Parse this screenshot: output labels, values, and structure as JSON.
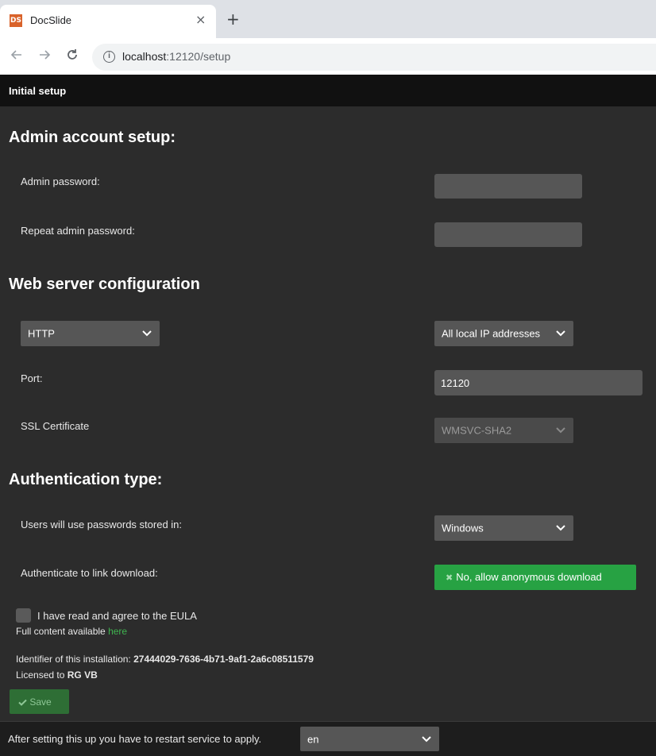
{
  "browser": {
    "tab_title": "DocSlide",
    "favicon_text": "DS",
    "close_glyph": "×",
    "new_tab_glyph": "+",
    "url_host": "localhost",
    "url_rest": ":12120/setup",
    "icons": [
      "back-arrow-icon",
      "forward-arrow-icon",
      "reload-icon",
      "info-icon"
    ]
  },
  "header": {
    "title": "Initial setup"
  },
  "admin": {
    "section_title": "Admin account setup:",
    "password_label": "Admin password:",
    "password_value": "",
    "repeat_label": "Repeat admin password:",
    "repeat_value": ""
  },
  "web": {
    "section_title": "Web server configuration",
    "protocol": "HTTP",
    "address": "All local IP addresses",
    "port_label": "Port:",
    "port_value": "12120",
    "ssl_label": "SSL Certificate",
    "ssl_value": "WMSVC-SHA2"
  },
  "auth": {
    "section_title": "Authentication type:",
    "store_label": "Users will use passwords stored in:",
    "store_value": "Windows",
    "link_label": "Authenticate to link download:",
    "link_button": "No, allow anonymous download"
  },
  "eula": {
    "checkbox_label": "I have read and agree to the EULA",
    "content_prefix": "Full content available",
    "content_link": "here",
    "checked": false
  },
  "install": {
    "identifier_label": "Identifier of this installation:",
    "identifier_value": "27444029-7636-4b71-9af1-2a6c08511579",
    "licensed_label": "Licensed to",
    "licensed_value": "RG VB"
  },
  "save_label": "Save",
  "footer": {
    "text": "After setting this up you have to restart service to apply.",
    "language": "en"
  },
  "colors": {
    "background": "#2c2c2c",
    "header": "#111111",
    "accent_green": "#27a243",
    "link_green": "#3fb34f"
  }
}
